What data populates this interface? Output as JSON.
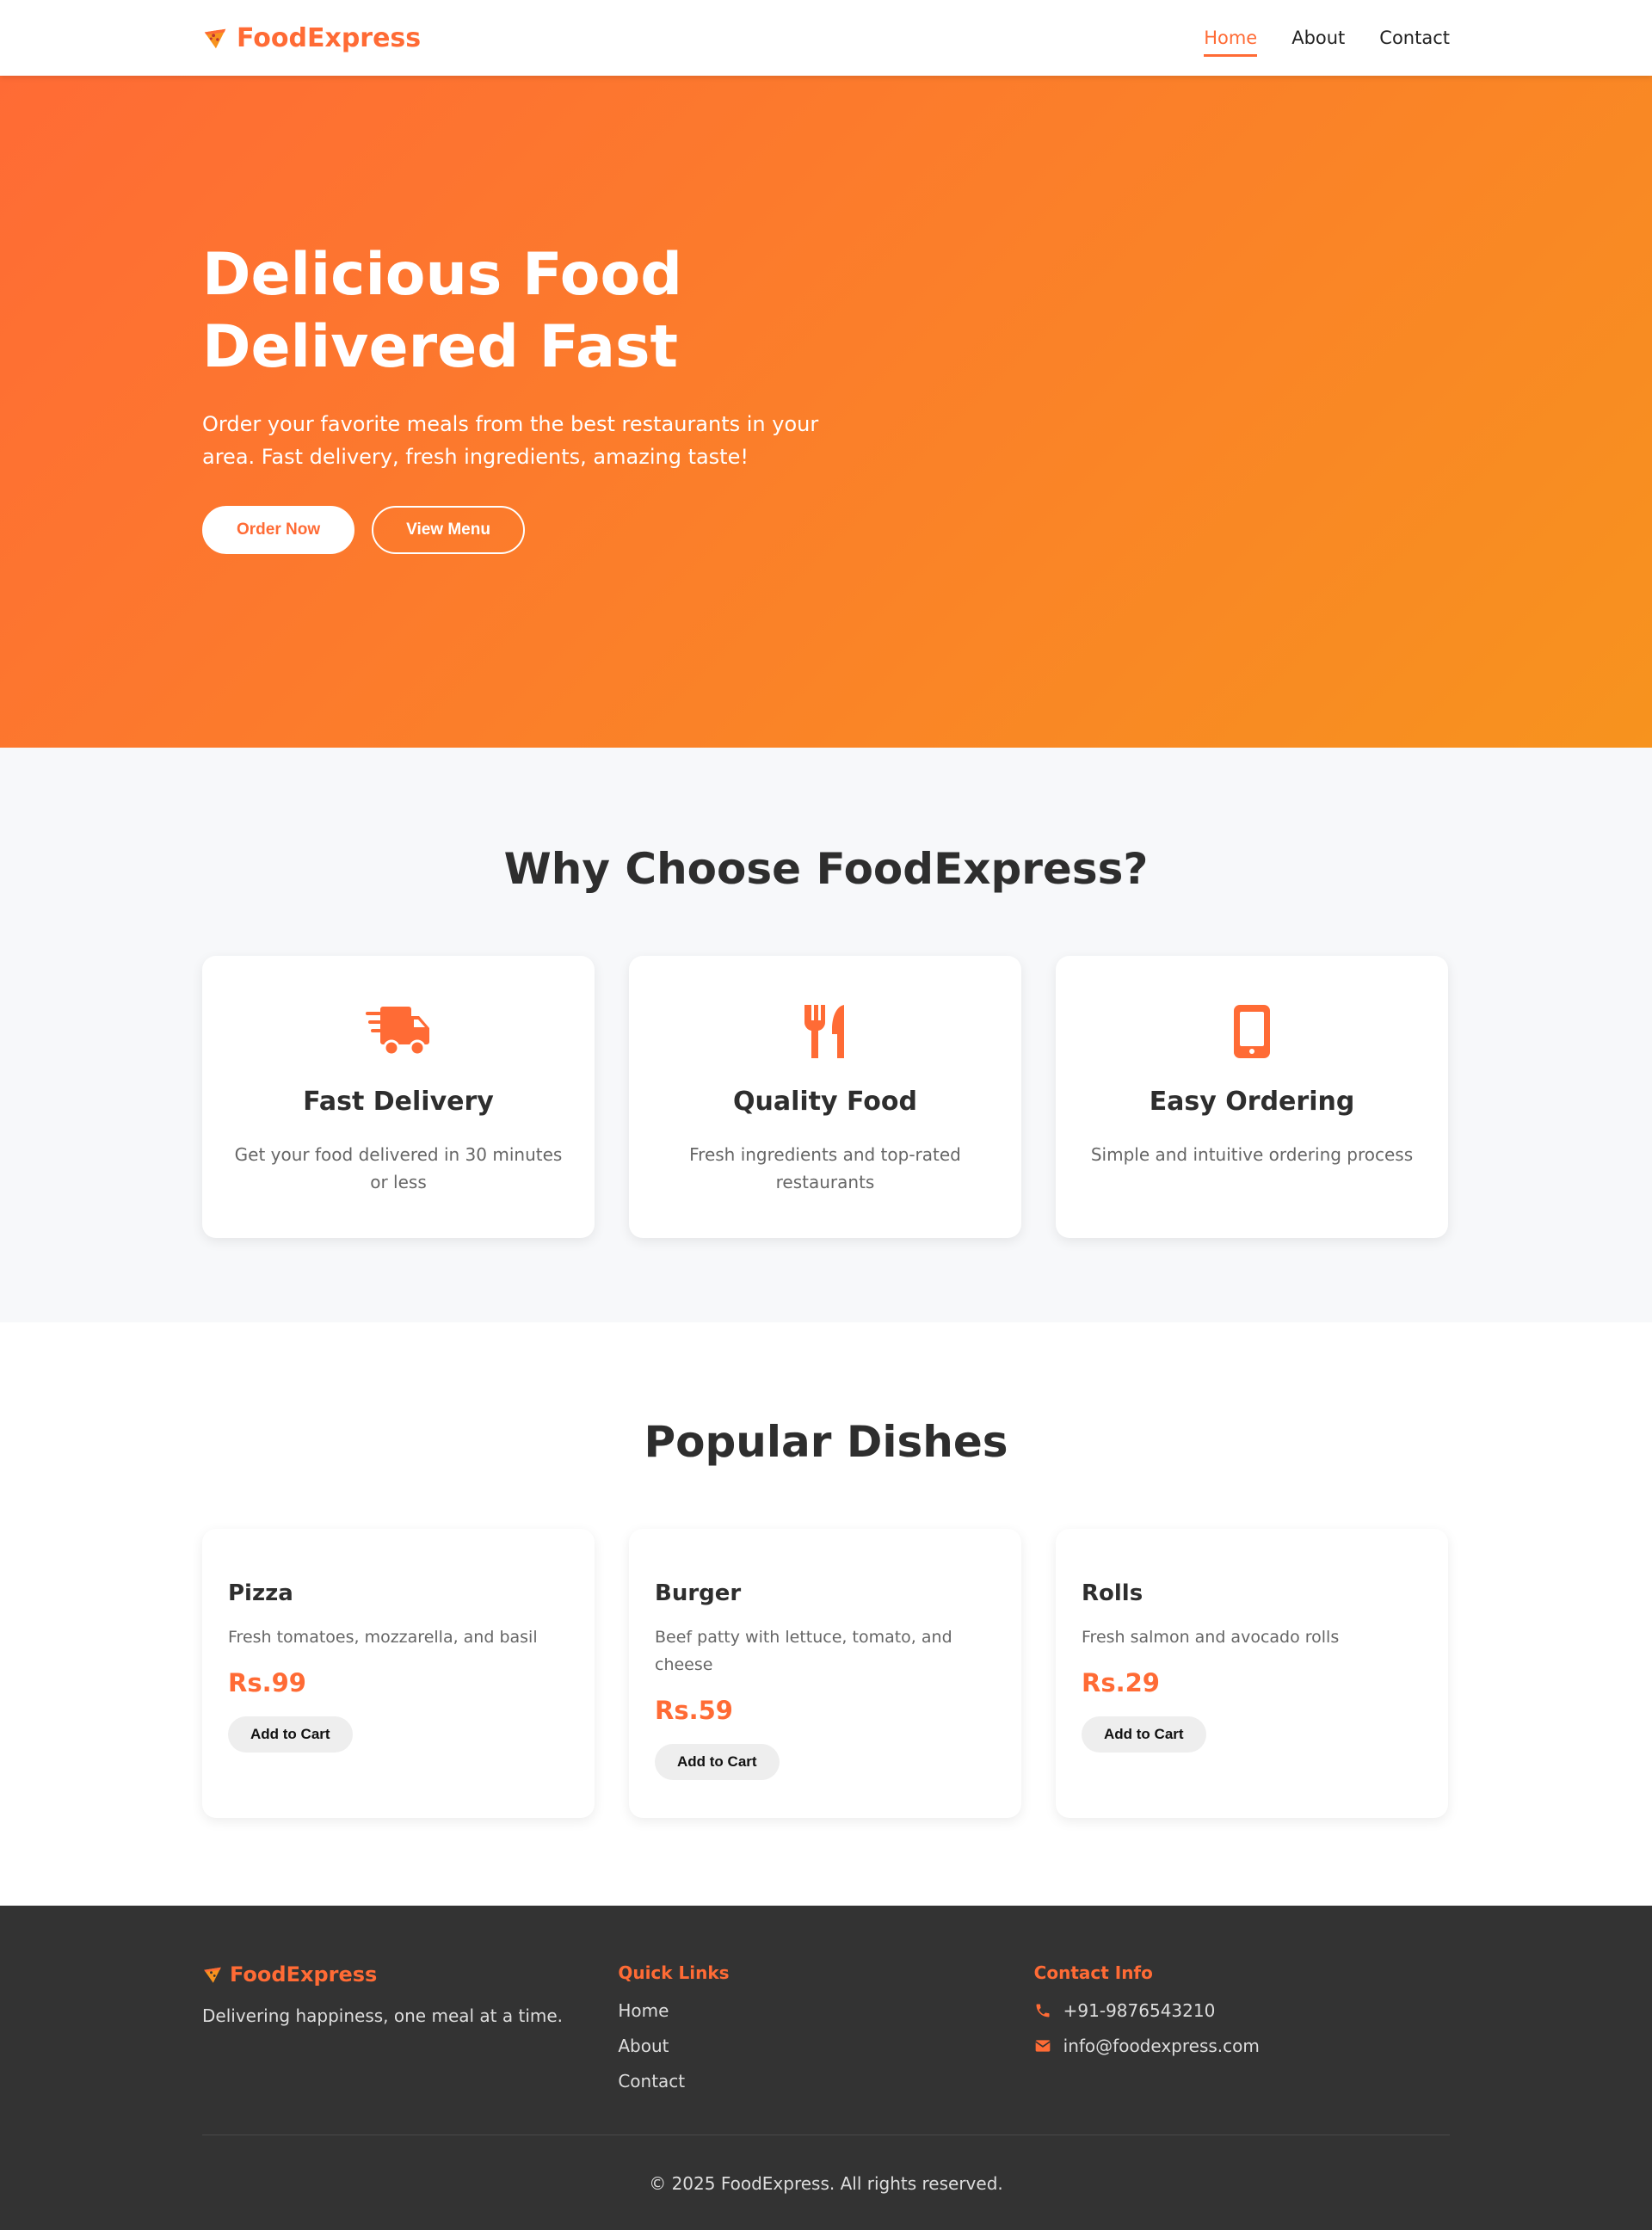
{
  "nav": {
    "brand": "FoodExpress",
    "links": [
      {
        "label": "Home",
        "active": true
      },
      {
        "label": "About",
        "active": false
      },
      {
        "label": "Contact",
        "active": false
      }
    ]
  },
  "hero": {
    "title": "Delicious Food Delivered Fast",
    "subtitle": "Order your favorite meals from the best restaurants in your area. Fast delivery, fresh ingredients, amazing taste!",
    "primary_button": "Order Now",
    "secondary_button": "View Menu"
  },
  "features": {
    "title": "Why Choose FoodExpress?",
    "items": [
      {
        "icon": "truck-icon",
        "title": "Fast Delivery",
        "text": "Get your food delivered in 30 minutes or less"
      },
      {
        "icon": "utensils-icon",
        "title": "Quality Food",
        "text": "Fresh ingredients and top-rated restaurants"
      },
      {
        "icon": "mobile-icon",
        "title": "Easy Ordering",
        "text": "Simple and intuitive ordering process"
      }
    ]
  },
  "dishes": {
    "title": "Popular Dishes",
    "add_to_cart": "Add to Cart",
    "items": [
      {
        "name": "Pizza",
        "description": "Fresh tomatoes, mozzarella, and basil",
        "price": "Rs.99"
      },
      {
        "name": "Burger",
        "description": "Beef patty with lettuce, tomato, and cheese",
        "price": "Rs.59"
      },
      {
        "name": "Rolls",
        "description": "Fresh salmon and avocado rolls",
        "price": "Rs.29"
      }
    ]
  },
  "footer": {
    "brand": "FoodExpress",
    "tagline": "Delivering happiness, one meal at a time.",
    "quick_links_title": "Quick Links",
    "quick_links": [
      "Home",
      "About",
      "Contact"
    ],
    "contact_title": "Contact Info",
    "phone": "+91-9876543210",
    "email": "info@foodexpress.com",
    "copyright": "© 2025 FoodExpress. All rights reserved."
  },
  "colors": {
    "accent": "#ff6b35",
    "hero_gradient_start": "#ff6b35",
    "hero_gradient_end": "#f7931e",
    "footer_bg": "#333333"
  }
}
